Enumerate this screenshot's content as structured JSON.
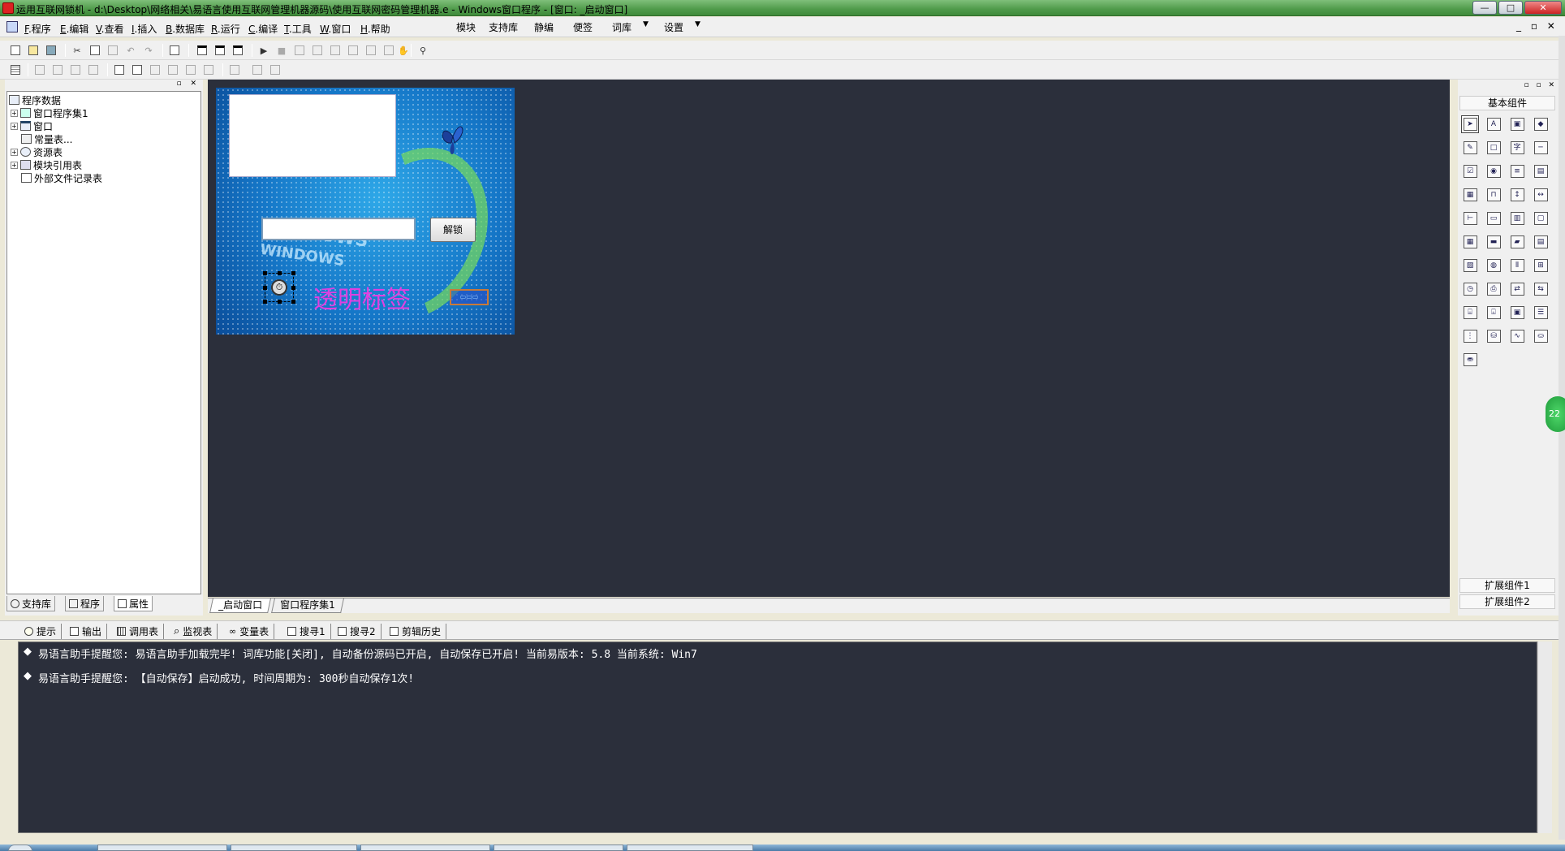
{
  "window": {
    "title": "运用互联网锁机 - d:\\Desktop\\网络相关\\易语言使用互联网管理机器源码\\使用互联网密码管理机器.e - Windows窗口程序 - [窗口: _启动窗口]",
    "minimize": "—",
    "maximize": "□",
    "close": "✕"
  },
  "menu": {
    "items": [
      {
        "key": "F",
        "label": ".程序"
      },
      {
        "key": "E",
        "label": ".编辑"
      },
      {
        "key": "V",
        "label": ".查看"
      },
      {
        "key": "I",
        "label": ".插入"
      },
      {
        "key": "B",
        "label": ".数据库"
      },
      {
        "key": "R",
        "label": ".运行"
      },
      {
        "key": "C",
        "label": ".编译"
      },
      {
        "key": "T",
        "label": ".工具"
      },
      {
        "key": "W",
        "label": ".窗口"
      },
      {
        "key": "H",
        "label": ".帮助"
      }
    ],
    "right_items": [
      "模块",
      "支持库",
      "静编",
      "便签",
      "词库",
      "设置"
    ],
    "mdi_buttons": "_ ▫ ✕"
  },
  "left_panel": {
    "header_buttons": "▫ ✕",
    "tree": [
      {
        "label": "程序数据",
        "expand": ""
      },
      {
        "label": "窗口程序集1",
        "expand": "+"
      },
      {
        "label": "窗口",
        "expand": "+"
      },
      {
        "label": "常量表...",
        "expand": ""
      },
      {
        "label": "资源表",
        "expand": "+"
      },
      {
        "label": "模块引用表",
        "expand": "+"
      },
      {
        "label": "外部文件记录表",
        "expand": ""
      }
    ],
    "tabs": [
      "支持库",
      "程序",
      "属性"
    ]
  },
  "form": {
    "unlock_button": "解锁",
    "transparent_label": "透明标签",
    "windows_text": "WINDOWS",
    "timer_glyph": "⏱",
    "small_box_text": "▭▭▭"
  },
  "doc_tabs": [
    "_启动窗口",
    "窗口程序集1"
  ],
  "right_panel": {
    "header_buttons": "▫ ▫ ✕",
    "title": "基本组件",
    "components": [
      "arrow-icon",
      "label-icon",
      "picture-icon",
      "shape-icon",
      "edit-icon",
      "frame-icon",
      "text-icon",
      "line-icon",
      "checkbox-icon",
      "radio-icon",
      "listbox-icon",
      "combobox-icon",
      "grid-icon",
      "tab-icon",
      "scroll-v-icon",
      "hscroll-icon",
      "slider-icon",
      "progress-icon",
      "table-icon",
      "dialog-icon",
      "calendar-icon",
      "button-icon",
      "folder-icon",
      "document-icon",
      "image-list-icon",
      "globe-icon",
      "split-icon",
      "tree-icon",
      "timer-icon",
      "printer-icon",
      "network-icon",
      "network2-icon",
      "server-icon",
      "client-icon",
      "frame2-icon",
      "list2-icon",
      "tree2-icon",
      "db-icon",
      "chart-icon",
      "odbc-icon",
      "odbc2-icon"
    ],
    "ext1": "扩展组件1",
    "ext2": "扩展组件2"
  },
  "bottom_tabs": [
    "提示",
    "输出",
    "调用表",
    "监视表",
    "变量表",
    "搜寻1",
    "搜寻2",
    "剪辑历史"
  ],
  "output": [
    "易语言助手提醒您:  易语言助手加载完毕!  词库功能[关闭], 自动备份源码已开启, 自动保存已开启!  当前易版本: 5.8  当前系统: Win7",
    "易语言助手提醒您: 【自动保存】启动成功, 时间周期为: 300秒自动保存1次!"
  ],
  "side_badge": "22"
}
